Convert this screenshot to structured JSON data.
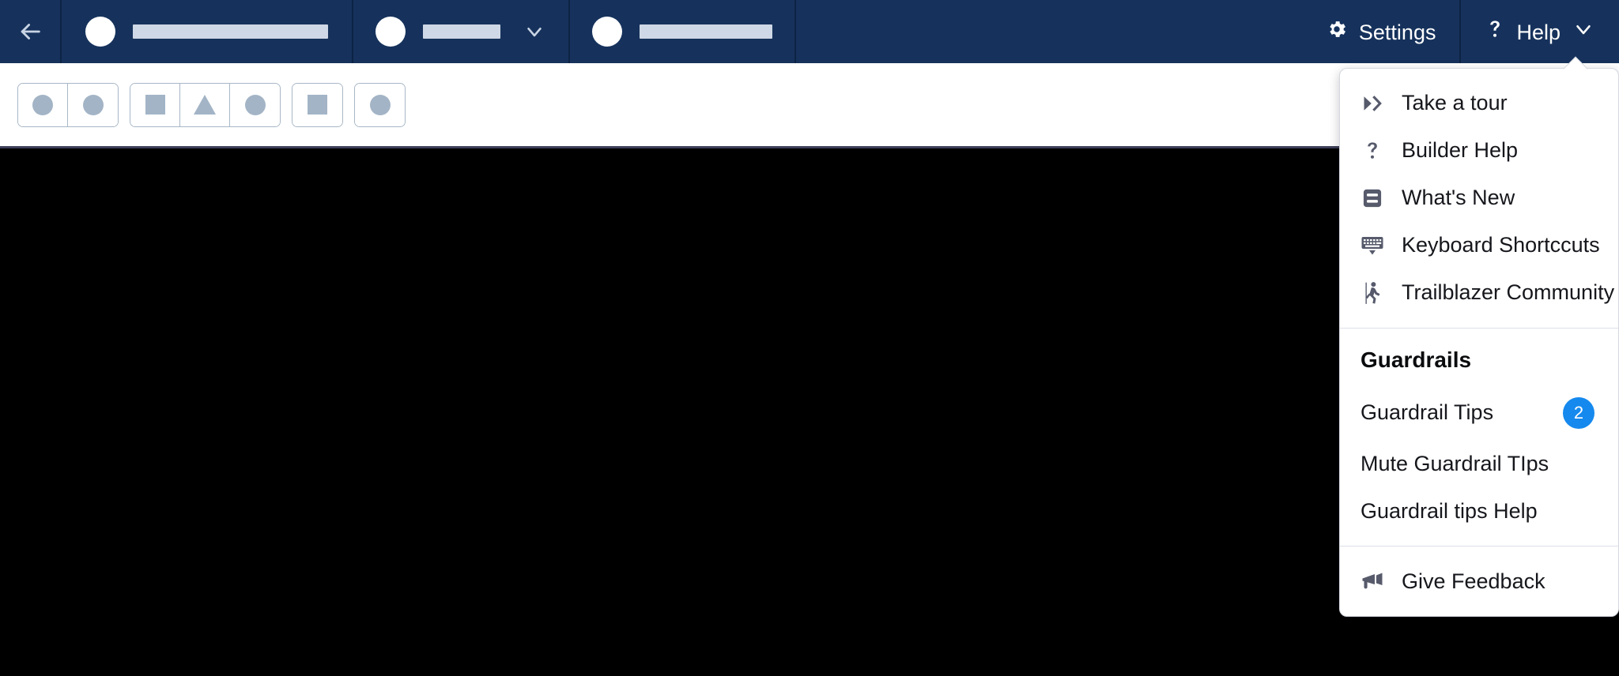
{
  "header": {
    "back_icon": "arrow-left-icon",
    "segments": [
      {
        "avatar": "app-avatar",
        "redacted_label": "",
        "has_chevron": false
      },
      {
        "avatar": "object-avatar",
        "redacted_label": "",
        "has_chevron": true
      },
      {
        "avatar": "record-avatar",
        "redacted_label": "",
        "has_chevron": false
      }
    ],
    "settings": {
      "label": "Settings",
      "icon": "gear-icon"
    },
    "help": {
      "label": "Help",
      "icon": "question-icon",
      "chevron": "chevron-down-icon"
    }
  },
  "toolbar": {
    "groups": [
      {
        "name": "undo-redo-group",
        "buttons": [
          {
            "name": "undo-button",
            "glyph": "circle"
          },
          {
            "name": "redo-button",
            "glyph": "circle"
          }
        ]
      },
      {
        "name": "device-preview-group",
        "buttons": [
          {
            "name": "desktop-view-button",
            "glyph": "square"
          },
          {
            "name": "tablet-view-button",
            "glyph": "triangle"
          },
          {
            "name": "mobile-view-button",
            "glyph": "circle"
          }
        ]
      },
      {
        "name": "refresh-group",
        "buttons": [
          {
            "name": "refresh-button",
            "glyph": "square"
          }
        ]
      },
      {
        "name": "analytics-group",
        "buttons": [
          {
            "name": "analytics-button",
            "glyph": "circle"
          }
        ]
      }
    ],
    "status_redacted": "",
    "right_buttons": [
      {
        "name": "save-button",
        "redacted_label": ""
      },
      {
        "name": "activate-button",
        "redacted_label": ""
      }
    ]
  },
  "help_menu": {
    "sections": [
      {
        "name": "help-links",
        "items": [
          {
            "label": "Take a tour",
            "icon": "fast-forward-icon"
          },
          {
            "label": "Builder Help",
            "icon": "question-icon"
          },
          {
            "label": "What's New",
            "icon": "news-icon"
          },
          {
            "label": "Keyboard Shortccuts",
            "icon": "keyboard-icon"
          },
          {
            "label": "Trailblazer Community",
            "icon": "hiker-icon"
          }
        ]
      },
      {
        "name": "guardrails",
        "heading": "Guardrails",
        "items": [
          {
            "label": "Guardrail Tips",
            "icon": "none",
            "badge": "2"
          },
          {
            "label": "Mute Guardrail TIps",
            "icon": "none"
          },
          {
            "label": "Guardrail tips Help",
            "icon": "none"
          }
        ]
      },
      {
        "name": "feedback",
        "items": [
          {
            "label": "Give Feedback",
            "icon": "megaphone-icon"
          }
        ]
      }
    ]
  },
  "colors": {
    "header_navy": "#16325C",
    "canvas_black": "#000000",
    "accent_blue": "#0B77DB",
    "badge_blue": "#1589EE",
    "redact_light": "#CFD8E6",
    "redact_dark": "#6B7189",
    "glyph_gray": "#A3B4C6"
  }
}
